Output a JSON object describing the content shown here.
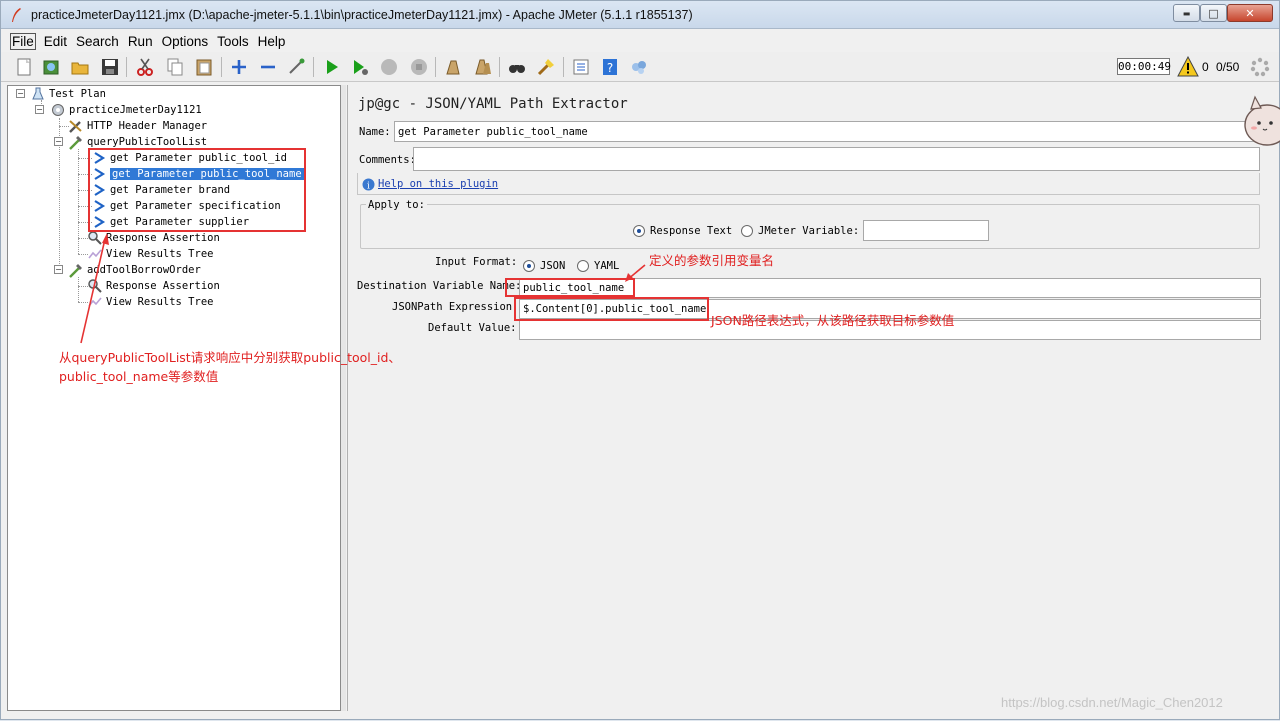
{
  "window": {
    "title": "practiceJmeterDay1121.jmx (D:\\apache-jmeter-5.1.1\\bin\\practiceJmeterDay1121.jmx) - Apache JMeter (5.1.1 r1855137)",
    "min_glyph": "▬",
    "max_glyph": "□",
    "close_glyph": "✕"
  },
  "menu": [
    "File",
    "Edit",
    "Search",
    "Run",
    "Options",
    "Tools",
    "Help"
  ],
  "toolbar": {
    "icons": [
      "new-icon",
      "templates-icon",
      "open-icon",
      "save-icon",
      "cut-icon",
      "copy-icon",
      "paste-icon",
      "expand-icon",
      "collapse-icon",
      "toggle-icon",
      "start-icon",
      "start-no-pause-icon",
      "stop-icon",
      "shutdown-icon",
      "clear-icon",
      "clear-all-icon",
      "search-icon",
      "reset-search-icon",
      "function-helper-icon",
      "help-icon",
      "remote-icon"
    ],
    "timer": "00:00:49",
    "warning_count": "0",
    "threads": "0/50"
  },
  "tree": {
    "test_plan": "Test Plan",
    "thread_group": "practiceJmeterDay1121",
    "header_manager": "HTTP Header Manager",
    "sampler1": "queryPublicToolList",
    "extractors": [
      "get Parameter public_tool_id",
      "get Parameter public_tool_name",
      "get Parameter brand",
      "get Parameter specification",
      "get Parameter supplier"
    ],
    "assertion1": "Response Assertion",
    "results1": "View Results Tree",
    "sampler2": "addToolBorrowOrder",
    "assertion2": "Response Assertion",
    "results2": "View Results Tree"
  },
  "panel": {
    "title": "jp@gc - JSON/YAML Path Extractor",
    "name_label": "Name:",
    "name_value": "get Parameter public_tool_name",
    "comments_label": "Comments:",
    "help_link": "Help on this plugin",
    "apply_to_label": "Apply to:",
    "response_text": "Response Text",
    "jmeter_variable": "JMeter Variable:",
    "input_format_label": "Input Format:",
    "json_option": "JSON",
    "yaml_option": "YAML",
    "dest_var_label": "Destination Variable Name:",
    "dest_var_value": "public_tool_name",
    "jsonpath_label": "JSONPath Expression:",
    "jsonpath_value": "$.Content[0].public_tool_name",
    "default_label": "Default Value:",
    "default_value": ""
  },
  "annotations": {
    "var_name_note": "定义的参数引用变量名",
    "jsonpath_note": "JSON路径表达式，从该路径获取目标参数值",
    "tree_note_line1": "从queryPublicToolList请求响应中分别获取public_tool_id、",
    "tree_note_line2": "public_tool_name等参数值"
  },
  "watermark": "https://blog.csdn.net/Magic_Chen2012",
  "colors": {
    "annotation_red": "#e53333",
    "selection_blue": "#3079d6",
    "link_blue": "#1a3fb0"
  }
}
